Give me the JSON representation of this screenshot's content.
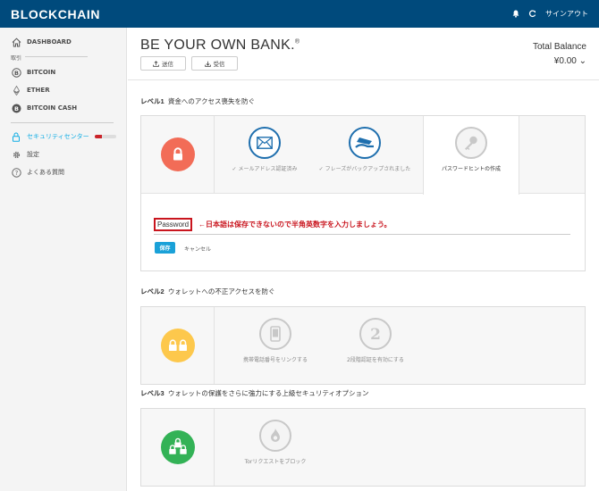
{
  "header": {
    "brand": "BLOCKCHAIN",
    "signout_label": "サインアウト",
    "icons": [
      "bell-icon",
      "refresh-icon"
    ],
    "bg_color": "#004a7c"
  },
  "sidebar": {
    "dashboard_label": "DASHBOARD",
    "section_label": "取引",
    "bitcoin_label": "BITCOIN",
    "ether_label": "ETHER",
    "bitcoin_cash_label": "BITCOIN CASH",
    "security_label": "セキュリティセンター",
    "security_progress": 0.35,
    "settings_label": "設定",
    "faq_label": "よくある質問",
    "active_color": "#10ade4"
  },
  "main": {
    "headline": "BE YOUR OWN BANK.",
    "headline_mark": "®",
    "send_label": "送信",
    "receive_label": "受信",
    "balance_label": "Total Balance",
    "balance_value": "¥0.00"
  },
  "level1": {
    "title_prefix": "レベル1",
    "title_text": "資金へのアクセス喪失を防ぐ",
    "lock_color": "#f26c57",
    "steps": [
      {
        "label": "✓ メールアドレス認証済み",
        "icon": "envelope-icon"
      },
      {
        "label": "✓ フレーズがバックアップされました",
        "icon": "hand-paper-icon"
      },
      {
        "label": "パスワードヒントの作成",
        "icon": "key-icon"
      }
    ],
    "password_placeholder": "Password",
    "annotation": "←日本語は保存できないので半角英数字を入力しましょう。",
    "save_label": "保存",
    "cancel_label": "キャンセル"
  },
  "level2": {
    "title_prefix": "レベル2",
    "title_text": "ウォレットへの不正アクセスを防ぐ",
    "lock_color": "#fdc84c",
    "steps": [
      {
        "label": "携帯電話番号をリンクする",
        "icon": "phone-icon"
      },
      {
        "label": "2段階認証を有効にする",
        "icon": "two-icon"
      }
    ]
  },
  "level3": {
    "title_prefix": "レベル3",
    "title_text": "ウォレットの保護をさらに強力にする上級セキュリティオプション",
    "lock_color": "#33b256",
    "steps": [
      {
        "label": "Torリクエストをブロック",
        "icon": "tor-icon"
      }
    ]
  }
}
